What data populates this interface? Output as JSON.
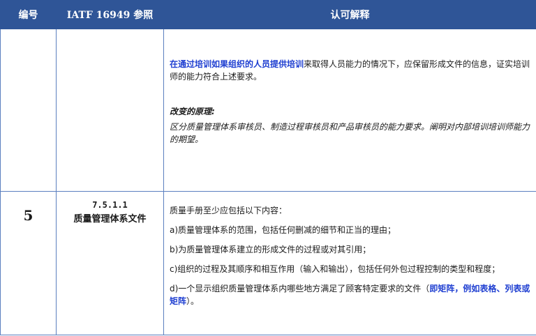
{
  "header": {
    "col_number": "编号",
    "col_ref": "IATF 16949 参照",
    "col_interp": "认可解释"
  },
  "row1": {
    "para_lead_blue": "在通过培训如果组织的人员提供培训",
    "para_rest": "来取得人员能力的情况下，应保留形成文件的信息，证实培训师的能力符合上述要求。",
    "rationale_title": "改变的原理:",
    "rationale_body": "区分质量管理体系审核员、制造过程审核员和产品审核员的能力要求。阐明对内部培训培训师能力的期望。"
  },
  "row2": {
    "number": "5",
    "ref_code": "7.5.1.1",
    "ref_title": "质量管理体系文件",
    "intro": "质量手册至少应包括以下内容：",
    "item_a": "a)质量管理体系的范围，包括任何删减的细节和正当的理由；",
    "item_b": "b)为质量管理体系建立的形成文件的过程或对其引用；",
    "item_c": "c)组织的过程及其顺序和相互作用（输入和输出），包括任何外包过程控制的类型和程度；",
    "item_d_text": "d)一个显示组织质量管理体系内哪些地方满足了顾客特定要求的文件（",
    "item_d_blue": "即矩阵，例如表格、列表或矩阵",
    "item_d_end": "）。"
  }
}
